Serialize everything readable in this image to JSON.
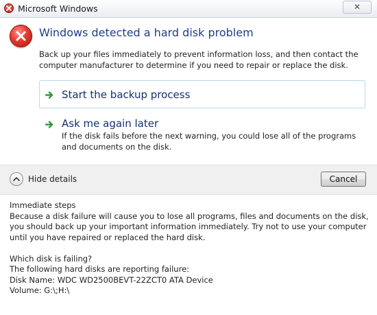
{
  "window": {
    "title": "Microsoft Windows",
    "close_label": "✕",
    "icon": "error-icon"
  },
  "main": {
    "icon": "error-icon",
    "heading": "Windows detected a hard disk problem",
    "body": "Back up your files immediately to prevent information loss, and then contact the computer manufacturer to determine if you need to repair or replace the disk.",
    "options": [
      {
        "title": "Start the backup process",
        "description": "",
        "icon": "green-arrow-icon",
        "selected": true
      },
      {
        "title": "Ask me again later",
        "description": "If the disk fails before the next warning, you could lose all of the programs and documents on the disk.",
        "icon": "green-arrow-icon",
        "selected": false
      }
    ]
  },
  "footer": {
    "toggle_label": "Hide details",
    "toggle_icon": "chevron-up-icon",
    "cancel_label": "Cancel"
  },
  "details": {
    "heading": "Immediate steps",
    "steps_text": "Because a disk failure will cause you to lose all programs, files and documents on the disk, you should back up your important information immediately.  Try not to use your computer until you have repaired or replaced the hard disk.",
    "failing_heading": "Which disk is failing?",
    "failing_intro": "The following hard disks are reporting failure:",
    "disk_name": "Disk Name: WDC WD2500BEVT-22ZCT0 ATA Device",
    "volume": "Volume: G:\\;H:\\"
  },
  "colors": {
    "heading": "#1c3e8c",
    "link": "#15306e",
    "arrow": "#2f9a3a",
    "error_red": "#e53a30",
    "footer_bg": "#f0f0f0",
    "selected_border": "#b7d9e7"
  }
}
